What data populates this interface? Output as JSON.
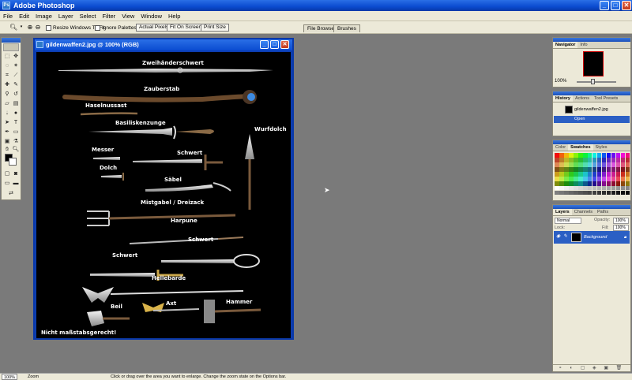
{
  "window": {
    "title": "Adobe Photoshop",
    "minimize": "_",
    "maximize": "□",
    "close": "✕"
  },
  "menu": [
    "File",
    "Edit",
    "Image",
    "Layer",
    "Select",
    "Filter",
    "View",
    "Window",
    "Help"
  ],
  "options": {
    "resize_label": "Resize Windows To Fit",
    "ignore_palettes_label": "Ignore Palettes",
    "actual_pixels": "Actual Pixels",
    "fit_on_screen": "Fit On Screen",
    "print_size": "Print Size"
  },
  "palette_well": [
    "File Browser",
    "Brushes"
  ],
  "document": {
    "title": "gildenwaffen2.jpg @ 100% (RGB)",
    "labels": {
      "zweihaenderschwert": "Zweihänderschwert",
      "zauberstab": "Zauberstab",
      "haselnussast": "Haselnussast",
      "basiliskenzunge": "Basiliskenzunge",
      "wurfdolch": "Wurfdolch",
      "messer": "Messer",
      "schwert1": "Schwert",
      "dolch": "Dolch",
      "saebel": "Säbel",
      "mistgabel": "Mistgabel / Dreizack",
      "harpune": "Harpune",
      "schwert2": "Schwert",
      "schwert3": "Schwert",
      "hellebarde": "Hellebarde",
      "beil": "Beil",
      "axt": "Axt",
      "hammer": "Hammer",
      "note": "Nicht maßstabsgerecht!"
    }
  },
  "navigator": {
    "tabs": [
      "Navigator",
      "Info"
    ],
    "zoom": "100%"
  },
  "history": {
    "tabs": [
      "History",
      "Actions",
      "Tool Presets"
    ],
    "items": [
      "gildenwaffen2.jpg",
      "Open"
    ]
  },
  "color": {
    "tabs": [
      "Color",
      "Swatches",
      "Styles"
    ]
  },
  "layers": {
    "tabs": [
      "Layers",
      "Channels",
      "Paths"
    ],
    "blend": "Normal",
    "opacity_label": "Opacity:",
    "opacity": "100%",
    "lock_label": "Lock:",
    "fill_label": "Fill:",
    "fill": "100%",
    "layer_name": "Background"
  },
  "status": {
    "zoom": "100%",
    "doc": "Zoom",
    "hint": "Click or drag over the area you want to enlarge. Change the zoom state on the Options bar."
  },
  "colors": {
    "accent": "#0a4bd0",
    "chrome": "#ece9d8",
    "workspace": "#7a7a7a"
  }
}
